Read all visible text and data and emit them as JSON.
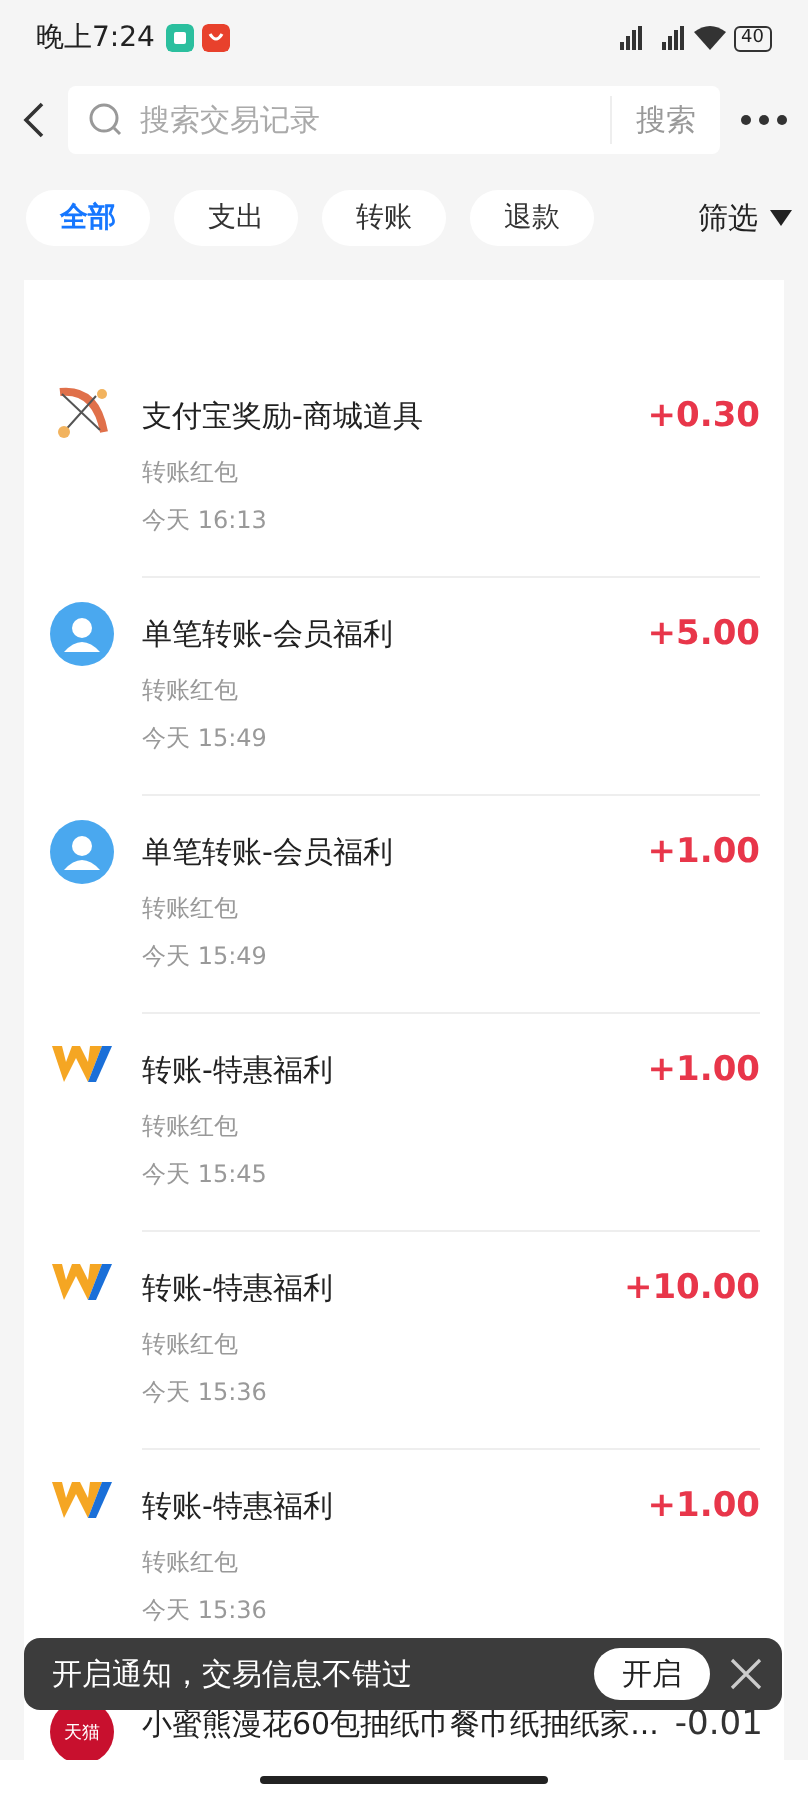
{
  "status_bar": {
    "time": "晚上7:24",
    "battery": "40"
  },
  "header": {
    "search": {
      "placeholder": "搜索交易记录"
    },
    "search_button": "搜索"
  },
  "tabs": [
    {
      "label": "全部",
      "selected": true
    },
    {
      "label": "支出",
      "selected": false
    },
    {
      "label": "转账",
      "selected": false
    },
    {
      "label": "退款",
      "selected": false
    }
  ],
  "filter": "筛选",
  "transactions": [
    {
      "kind": "reward",
      "title": "支付宝奖励-商城道具",
      "subtitle": "转账红包",
      "time": "今天 16:13",
      "amount": "+0.30",
      "income": true
    },
    {
      "kind": "person",
      "title": "单笔转账-会员福利",
      "subtitle": "转账红包",
      "time": "今天 15:49",
      "amount": "+5.00",
      "income": true
    },
    {
      "kind": "person",
      "title": "单笔转账-会员福利",
      "subtitle": "转账红包",
      "time": "今天 15:49",
      "amount": "+1.00",
      "income": true
    },
    {
      "kind": "merchant",
      "title": "转账-特惠福利",
      "subtitle": "转账红包",
      "time": "今天 15:45",
      "amount": "+1.00",
      "income": true
    },
    {
      "kind": "merchant",
      "title": "转账-特惠福利",
      "subtitle": "转账红包",
      "time": "今天 15:36",
      "amount": "+10.00",
      "income": true
    },
    {
      "kind": "merchant",
      "title": "转账-特惠福利",
      "subtitle": "转账红包",
      "time": "今天 15:36",
      "amount": "+1.00",
      "income": true
    },
    {
      "kind": "store",
      "store_label": "天猫",
      "title": "小蜜熊漫花60包抽纸巾餐巾纸抽纸家...",
      "amount": "-0.01",
      "income": false
    }
  ],
  "toast": {
    "message": "开启通知，交易信息不错过",
    "button": "开启"
  }
}
